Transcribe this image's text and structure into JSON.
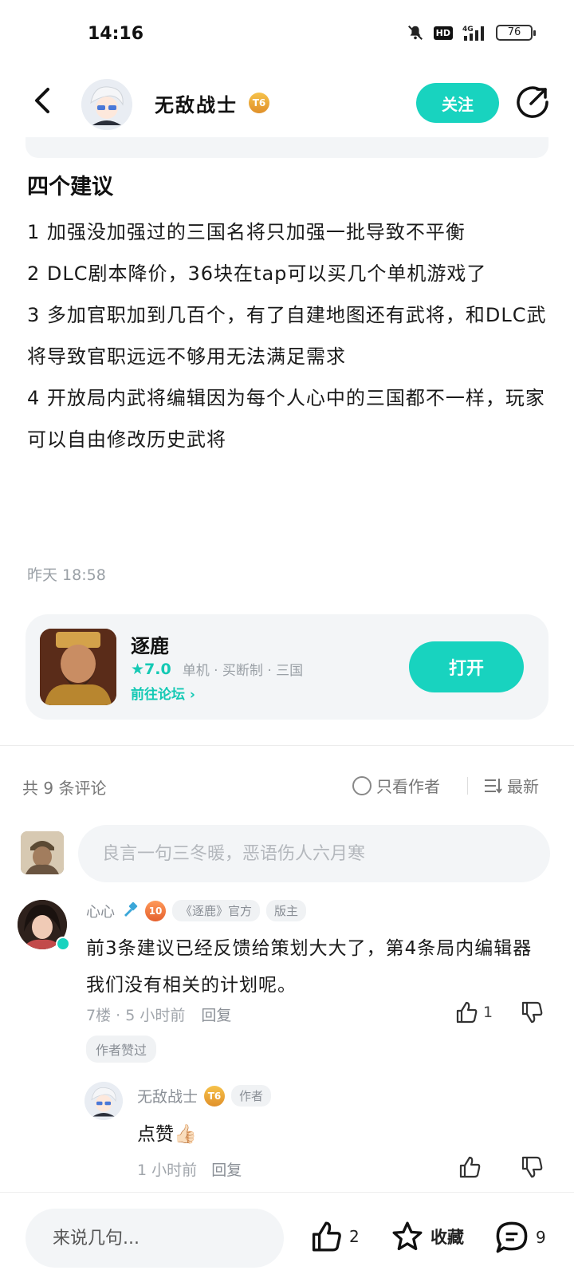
{
  "status": {
    "time": "14:16",
    "hd_label": "HD",
    "network_label": "4G",
    "battery": "76"
  },
  "nav": {
    "author_name": "无敌战士",
    "author_level": "T6",
    "follow_label": "关注"
  },
  "post": {
    "title": "四个建议",
    "paragraphs": [
      "1 加强没加强过的三国名将只加强一批导致不平衡",
      "2 DLC剧本降价，36块在tap可以买几个单机游戏了",
      "3 多加官职加到几百个，有了自建地图还有武将，和DLC武将导致官职远远不够用无法满足需求",
      "4 开放局内武将编辑因为每个人心中的三国都不一样，玩家可以自由修改历史武将"
    ],
    "time": "昨天 18:58"
  },
  "game": {
    "name": "逐鹿",
    "rating": "★7.0",
    "tags": "单机 · 买断制 · 三国",
    "forum_link": "前往论坛 ›",
    "open_label": "打开"
  },
  "comments_bar": {
    "count": "共 9 条评论",
    "author_only": "只看作者",
    "sort": "最新"
  },
  "compose": {
    "placeholder": "良言一句三冬暖，恶语伤人六月寒"
  },
  "comment": {
    "name": "心心",
    "level": "10",
    "tag_game": "《逐鹿》官方",
    "tag_role": "版主",
    "text": "前3条建议已经反馈给策划大大了，第4条局内编辑器我们没有相关的计划呢。",
    "floor": "7楼",
    "time": "5 小时前",
    "reply": "回复",
    "likes": "1",
    "liked_by_author": "作者赞过"
  },
  "reply_item": {
    "name": "无敌战士",
    "level": "T6",
    "tag": "作者",
    "text": "点赞👍🏻",
    "time": "1 小时前",
    "reply": "回复"
  },
  "bottom": {
    "input_placeholder": "来说几句...",
    "like_count": "2",
    "favorite_label": "收藏",
    "comment_count": "9"
  },
  "colors": {
    "accent": "#18d3bf",
    "muted_text": "#9aa0a6",
    "card_bg": "#f3f5f7"
  }
}
